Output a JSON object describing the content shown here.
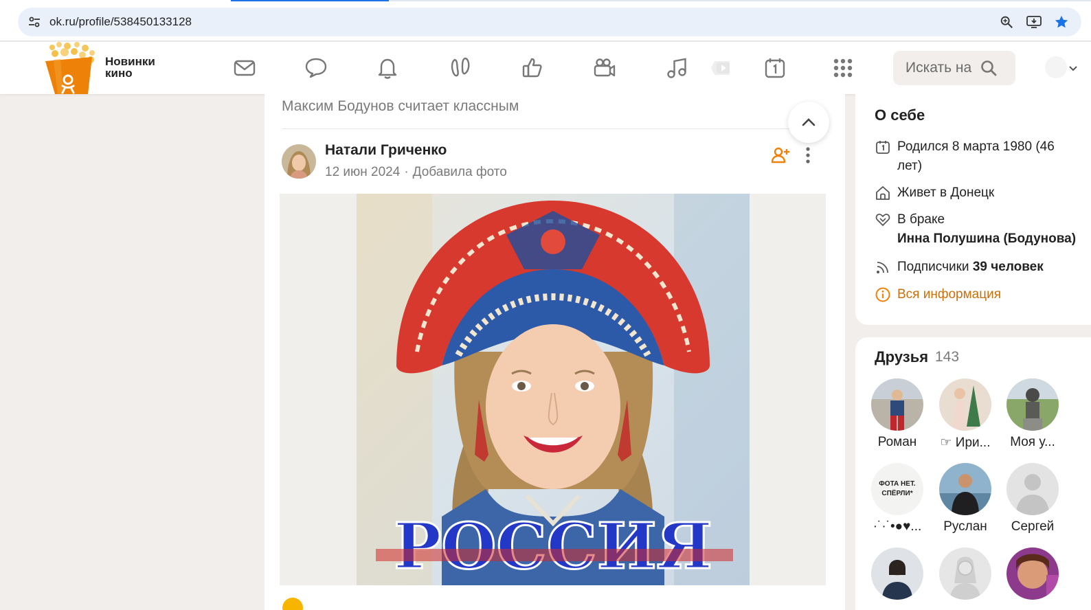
{
  "browser": {
    "url": "ok.ru/profile/538450133128"
  },
  "header": {
    "logo_label": "Новинки кино",
    "logo_line1": "Новинки",
    "logo_line2": "кино",
    "nav_icons": [
      "mail-icon",
      "chat-icon",
      "bell-icon",
      "guests-icon",
      "like-icon",
      "video-camera-icon",
      "music-icon",
      "play-icon",
      "calendar-icon",
      "apps-grid-icon"
    ],
    "search_placeholder": "Искать на",
    "accent_color": "#ee8208"
  },
  "feed": {
    "liked_by": "Максим Бодунов считает классным",
    "post": {
      "author": "Натали Гриченко",
      "date": "12 июн 2024",
      "action": "Добавила фото",
      "image_caption": "РОССИЯ"
    }
  },
  "about": {
    "title": "О себе",
    "born_line1": "Родился 8 марта 1980 (46",
    "born_line2": "лет)",
    "lives": "Живет в Донецк",
    "married_label": "В браке",
    "spouse": "Инна Полушина (Бодунова)",
    "subscribers_label": "Подписчики",
    "subscribers_value": "39 человек",
    "all_info": "Вся информация"
  },
  "friends": {
    "title": "Друзья",
    "count": "143",
    "items": [
      {
        "name": "Роман"
      },
      {
        "name": "☞ Ири..."
      },
      {
        "name": "Моя у..."
      },
      {
        "name": "·˙·˙•●♥..."
      },
      {
        "name": "Руслан"
      },
      {
        "name": "Сергей"
      },
      {
        "name": ""
      },
      {
        "name": ""
      },
      {
        "name": ""
      }
    ],
    "avatar_badge_text": "ФОТА НЕТ. СПЁРЛИ*"
  }
}
